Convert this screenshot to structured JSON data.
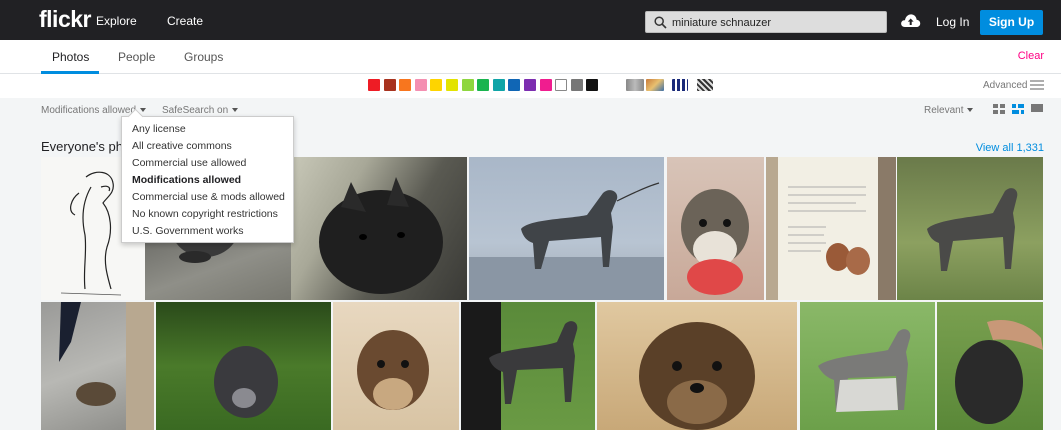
{
  "header": {
    "logo": "flickr",
    "nav": [
      "Explore",
      "Create"
    ],
    "search_value": "miniature schnauzer",
    "login": "Log In",
    "signup": "Sign Up"
  },
  "tabs": {
    "items": [
      "Photos",
      "People",
      "Groups"
    ],
    "active": "Photos",
    "clear": "Clear"
  },
  "colors": {
    "swatches": [
      "#ee1c25",
      "#a8331f",
      "#f8761e",
      "#f48fb1",
      "#fed400",
      "#e3e300",
      "#8ed63f",
      "#19b44e",
      "#0fa4a7",
      "#1066b5",
      "#7c2eb0",
      "#f01d8f",
      "#ffffff",
      "#777777",
      "#111111"
    ],
    "advanced": "Advanced"
  },
  "filters": {
    "license": "Modifications allowed",
    "safesearch": "SafeSearch on",
    "sort": "Relevant"
  },
  "results": {
    "heading": "Everyone's photos",
    "view_all": "View all 1,331"
  },
  "license_menu": {
    "items": [
      "Any license",
      "All creative commons",
      "Commercial use allowed",
      "Modifications allowed",
      "Commercial use & mods allowed",
      "No known copyright restrictions",
      "U.S. Government works"
    ],
    "selected": "Modifications allowed"
  }
}
